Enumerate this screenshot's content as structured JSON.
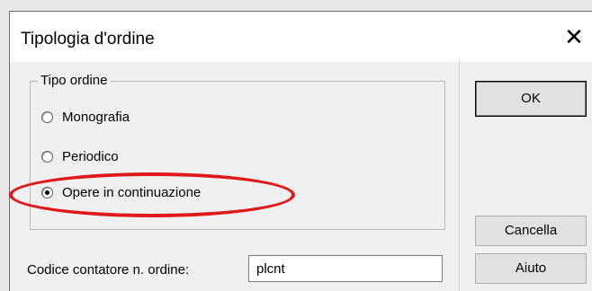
{
  "dialog": {
    "title": "Tipologia d'ordine",
    "close_glyph": "✕"
  },
  "group": {
    "legend": "Tipo ordine",
    "options": [
      {
        "label": "Monografia",
        "checked": false
      },
      {
        "label": "Periodico",
        "checked": false
      },
      {
        "label": "Opere in continuazione",
        "checked": true
      }
    ]
  },
  "buttons": {
    "ok": "OK",
    "cancel": "Cancella",
    "help": "Aiuto"
  },
  "counter": {
    "label": "Codice contatore n. ordine:",
    "value": "plcnt"
  },
  "colors": {
    "annotation": "#e01a1a",
    "dialog_bg": "#f0f0f0"
  }
}
